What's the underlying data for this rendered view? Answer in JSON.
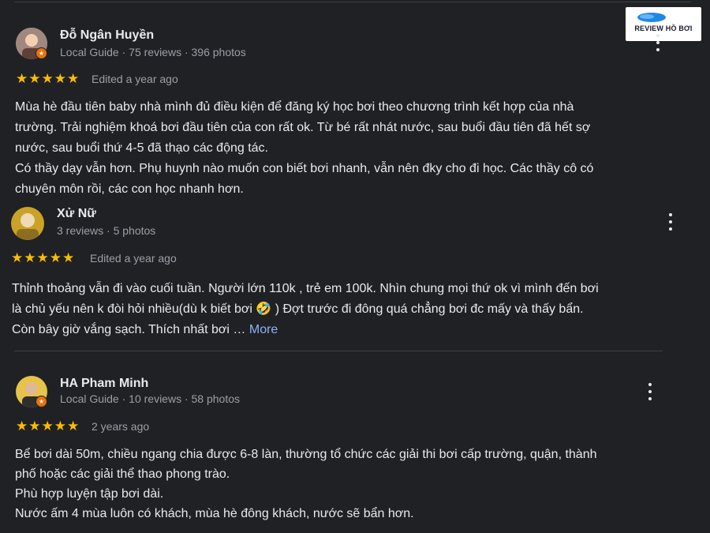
{
  "reviews": [
    {
      "name": "Đỗ Ngân Huyền",
      "meta": "Local Guide · 75 reviews · 396 photos",
      "rating": 5,
      "date": "Edited a year ago",
      "text": "Mùa hè đầu tiên baby nhà mình đủ điều kiện để đăng ký học bơi theo chương trình kết hợp của nhà\ntrường. Trải nghiệm khoá bơi đầu tiên của con rất ok. Từ bé rất nhát nước, sau buổi đầu tiên đã hết sợ\nnước, sau buổi thứ 4-5 đã thạo các động tác.\nCó thầy dạy vẫn hơn. Phụ huynh nào muốn con biết bơi nhanh, vẫn nên đky cho đi học. Các thầy cô có\nchuyên môn rồi, các con học nhanh hơn."
    },
    {
      "name": "Xử Nữ",
      "meta": "3 reviews · 5 photos",
      "rating": 5,
      "date": "Edited a year ago",
      "text": "Thỉnh thoảng vẫn đi vào cuối tuần. Người lớn 110k , trẻ em 100k. Nhìn chung mọi thứ ok vì mình đến bơi\nlà chủ yếu nên k đòi hỏi nhiều(dù k biết bơi 🤣 ) Đợt trước đi đông quá chẳng bơi đc mấy và thấy bẩn.\nCòn bây giờ vắng sạch. Thích nhất bơi … ",
      "more_label": "More"
    },
    {
      "name": "HA Pham Minh",
      "meta": "Local Guide · 10 reviews · 58 photos",
      "rating": 5,
      "date": "2 years ago",
      "text": "Bể bơi dài 50m, chiều ngang chia được 6-8 làn, thường tổ chức các giải thi bơi cấp trường, quận, thành\nphố hoặc các giải thể thao phong trào.\nPhù hợp luyện tập bơi dài.\nNước ấm 4 mùa luôn có khách, mùa hè đông khách, nước sẽ bẩn hơn."
    }
  ],
  "logo": {
    "text": "REVIEW HỒ BƠI"
  },
  "colors": {
    "background": "#202124",
    "star": "#fbbc04",
    "link": "#8ab4f8",
    "badge": "#e8710a"
  }
}
